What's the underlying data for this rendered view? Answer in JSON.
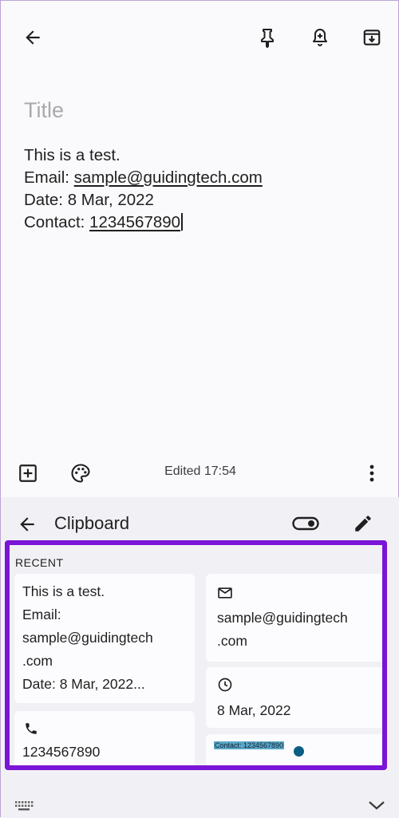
{
  "app": {
    "title_placeholder": "Title",
    "note_lines": {
      "line1": "This is a test.",
      "email_prefix": "Email: ",
      "email": "sample@guidingtech.com",
      "date": "Date: 8 Mar, 2022",
      "contact_prefix": "Contact: ",
      "contact": "1234567890"
    },
    "edited_label": "Edited 17:54",
    "icons": {
      "back": "arrow-left-icon",
      "pin": "pin-icon",
      "reminder": "bell-plus-icon",
      "archive": "archive-icon",
      "add": "add-box-icon",
      "palette": "palette-icon",
      "more": "more-vert-icon"
    }
  },
  "clipboard": {
    "title": "Clipboard",
    "recent_label": "RECENT",
    "items": [
      {
        "lines": [
          "This is a test.",
          "Email:",
          "sample@guidingtech",
          ".com",
          "Date: 8 Mar, 2022..."
        ]
      },
      {
        "icon": "mail-icon",
        "lines": [
          "sample@guidingtech",
          ".com"
        ]
      },
      {
        "icon": "clock-icon",
        "text": "8 Mar, 2022"
      },
      {
        "icon": "phone-icon",
        "text": "1234567890"
      },
      {
        "image_text": "Contact: 1234567890"
      }
    ],
    "accent_color": "#7a14d6",
    "icons": {
      "back": "arrow-left-icon",
      "toggle": "toggle-icon",
      "edit": "pencil-icon",
      "keyboard": "keyboard-icon",
      "collapse": "chevron-down-icon"
    }
  }
}
